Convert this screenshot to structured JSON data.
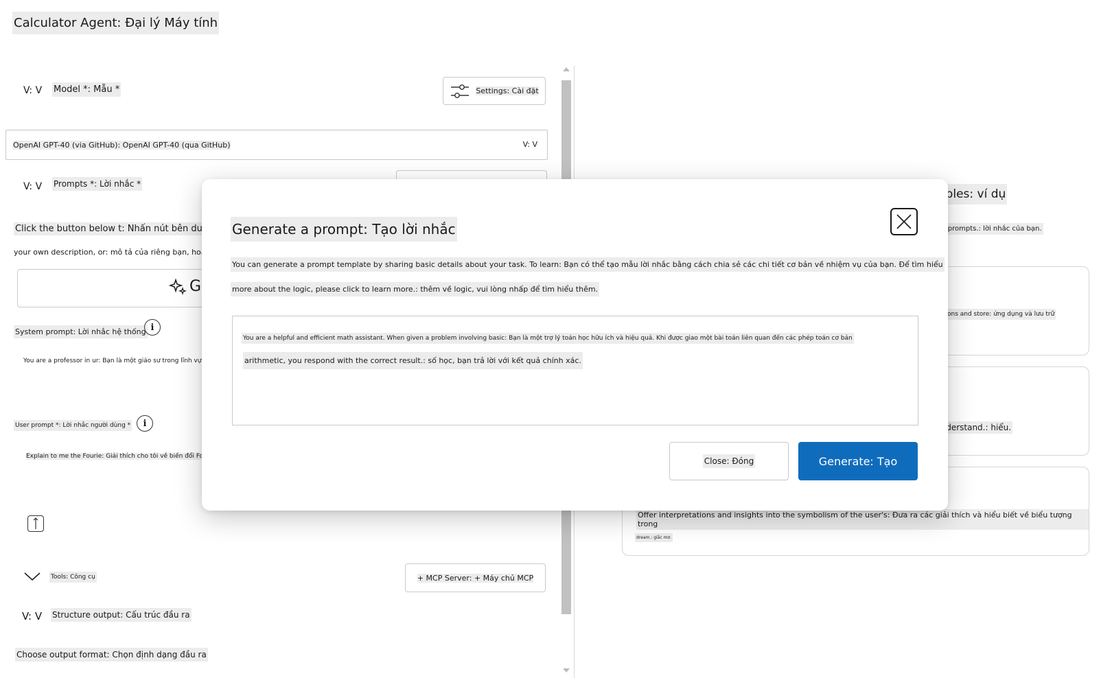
{
  "app": {
    "title": "Calculator Agent: Đại lý Máy tính"
  },
  "left_panel": {
    "model": {
      "toggle": "V: V",
      "label": "Model *: Mẫu *",
      "settings_label": "Settings: Cài đặt",
      "selected_model": "OpenAI GPT-40 (via GitHub): OpenAI GPT-40 (qua GitHub)",
      "select_chevron": "V: V"
    },
    "prompts": {
      "toggle": "V: V",
      "label": "Prompts *: Lời nhắc *",
      "instruction_line1": "Click the button below t: Nhấn nút bên dưới để",
      "instruction_line2": "your own description, or: mô tả của riêng bạn, hoặc",
      "generate_glyph": "G",
      "system_prompt_label": "System prompt: Lời nhắc hệ thống",
      "system_prompt_value": "You are a professor in ur: Bạn là một giáo sư trong lĩnh vực",
      "user_prompt_label": "User prompt *: Lời nhắc người dùng *",
      "user_prompt_value": "Explain to me the Fourie: Giải thích cho tôi về biến đổi Fourier"
    },
    "tools": {
      "label": "Tools: Công cụ",
      "mcp_button": "+ MCP Server: + Máy chủ MCP"
    },
    "structure_output": {
      "toggle": "V: V",
      "label": "Structure output: Cấu trúc đầu ra",
      "choose_format": "Choose output format: Chọn định dạng đầu ra"
    }
  },
  "right_panel": {
    "examples_title": "mples: ví dụ",
    "examples_subtitle": "our prompts.: lời nhắc của bạn.",
    "cards": [
      {
        "text": "ications and store: ứng dụng và lưu trữ"
      },
      {
        "text": "understand.: hiểu."
      },
      {
        "text": "Offer interpretations and insights into the symbolism of the user's: Đưa ra các giải thích và hiểu biết về biểu tượng trong",
        "text2": "dream.: giấc mơ."
      }
    ]
  },
  "modal": {
    "title": "Generate a prompt: Tạo lời nhắc",
    "description_line1": "You can generate a prompt template by sharing basic details about your task. To learn: Bạn có thể tạo mẫu lời nhắc bằng cách chia sẻ các chi tiết cơ bản về nhiệm vụ của bạn. Để tìm hiểu",
    "description_line2": "more about the logic, please click to learn more.: thêm về logic, vui lòng nhấp để tìm hiểu thêm.",
    "input_line1": "You are a helpful and efficient math assistant. When given a problem involving basic: Bạn là một trợ lý toán học hữu ích và hiệu quả. Khi được giao một bài toán liên quan đến các phép toán cơ bản",
    "input_line2": "arithmetic, you respond with the correct result.: số học, bạn trả lời với kết quả chính xác.",
    "close_label": "Close: Đóng",
    "generate_label": "Generate: Tạo"
  },
  "colors": {
    "primary": "#0f6cbd",
    "text_highlight": "#ececec",
    "border": "#c9c9c9"
  }
}
